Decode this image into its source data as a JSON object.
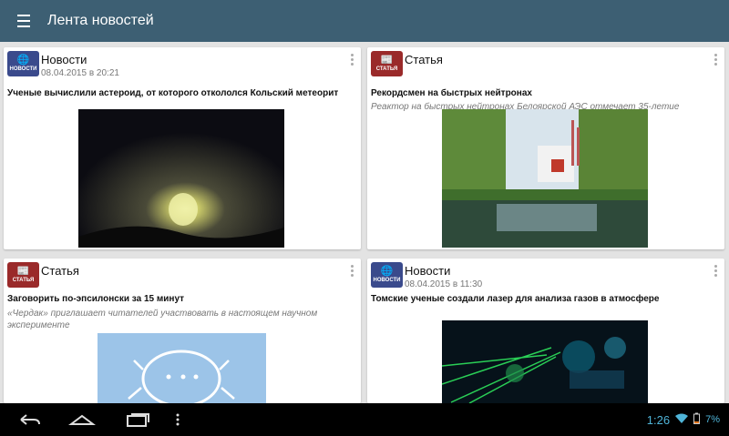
{
  "toolbar": {
    "title": "Лента новостей",
    "menu_icon": "hamburger-icon"
  },
  "cards": [
    {
      "type": "Новости",
      "badge": "НОВОСТИ",
      "badge_kind": "news",
      "date": "08.04.2015 в 20:21",
      "headline": "Ученые вычислили астероид, от которого откололся Кольский метеорит",
      "subtitle": ""
    },
    {
      "type": "Статья",
      "badge": "СТАТЬЯ",
      "badge_kind": "article",
      "date": "",
      "headline": "Рекордсмен на быстрых нейтронах",
      "subtitle": "Реактор на быстрых нейтронах Белоярской АЭС отмечает 35-летие"
    },
    {
      "type": "Статья",
      "badge": "СТАТЬЯ",
      "badge_kind": "article",
      "date": "",
      "headline": "Заговорить по-эпсилонски за 15 минут",
      "subtitle": "«Чердак» приглашает читателей участвовать в настоящем научном эксперименте"
    },
    {
      "type": "Новости",
      "badge": "НОВОСТИ",
      "badge_kind": "news",
      "date": "08.04.2015 в 11:30",
      "headline": "Томские ученые создали лазер для анализа газов в атмосфере",
      "subtitle": ""
    }
  ],
  "statusbar": {
    "time": "1:26",
    "battery": "7%"
  },
  "colors": {
    "toolbar": "#3d5f73",
    "news_badge": "#3a4a8c",
    "article_badge": "#9a2a2a",
    "status_accent": "#4fb4d8"
  }
}
